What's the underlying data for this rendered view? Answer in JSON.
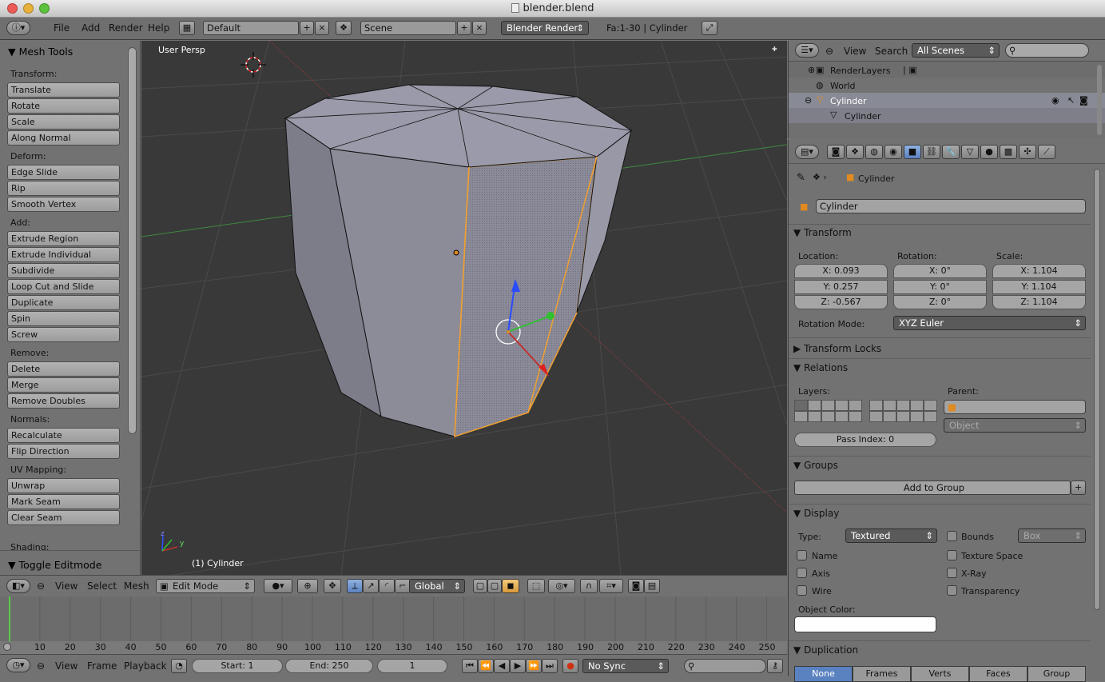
{
  "window": {
    "title": "blender.blend"
  },
  "topbar": {
    "menus": [
      "File",
      "Add",
      "Render",
      "Help"
    ],
    "layout": "Default",
    "scene": "Scene",
    "engine": "Blender Render",
    "stats": "Fa:1-30 | Cylinder"
  },
  "tools": {
    "title": "Mesh Tools",
    "sections": [
      {
        "label": "Transform:",
        "buttons": [
          "Translate",
          "Rotate",
          "Scale",
          "Along Normal"
        ]
      },
      {
        "label": "Deform:",
        "buttons": [
          "Edge Slide",
          "Rip",
          "Smooth Vertex"
        ]
      },
      {
        "label": "Add:",
        "buttons": [
          "Extrude Region",
          "Extrude Individual",
          "Subdivide",
          "Loop Cut and Slide",
          "Duplicate",
          "Spin",
          "Screw"
        ]
      },
      {
        "label": "Remove:",
        "buttons": [
          "Delete",
          "Merge",
          "Remove Doubles"
        ]
      },
      {
        "label": "Normals:",
        "buttons": [
          "Recalculate",
          "Flip Direction"
        ]
      },
      {
        "label": "UV Mapping:",
        "buttons": [
          "Unwrap",
          "Mark Seam",
          "Clear Seam"
        ]
      }
    ],
    "shading_label": "Shading:",
    "toggle": "Toggle Editmode"
  },
  "viewport": {
    "persp": "User Persp",
    "object": "(1) Cylinder"
  },
  "vpheader": {
    "menus": [
      "View",
      "Select",
      "Mesh"
    ],
    "mode": "Edit Mode",
    "orientation": "Global"
  },
  "timeline": {
    "ticks": [
      "10",
      "20",
      "30",
      "40",
      "50",
      "60",
      "70",
      "80",
      "90",
      "100",
      "110",
      "120",
      "130",
      "140",
      "150",
      "160",
      "170",
      "180",
      "190",
      "200",
      "210",
      "220",
      "230",
      "240",
      "250"
    ],
    "menus": [
      "View",
      "Frame",
      "Playback"
    ],
    "start": "Start: 1",
    "end": "End: 250",
    "current": "1",
    "sync": "No Sync"
  },
  "outliner": {
    "menus": [
      "View",
      "Search"
    ],
    "filter": "All Scenes",
    "items": [
      "RenderLayers",
      "World",
      "Cylinder",
      "Cylinder"
    ]
  },
  "props": {
    "breadcrumb": "Cylinder",
    "name": "Cylinder",
    "transform": {
      "title": "Transform",
      "location_label": "Location:",
      "rotation_label": "Rotation:",
      "scale_label": "Scale:",
      "location": [
        "X: 0.093",
        "Y: 0.257",
        "Z: -0.567"
      ],
      "rotation": [
        "X: 0°",
        "Y: 0°",
        "Z: 0°"
      ],
      "scale": [
        "X: 1.104",
        "Y: 1.104",
        "Z: 1.104"
      ],
      "mode_label": "Rotation Mode:",
      "mode": "XYZ Euler"
    },
    "locks_title": "Transform Locks",
    "relations": {
      "title": "Relations",
      "layers_label": "Layers:",
      "parent_label": "Parent:",
      "parent_type": "Object",
      "pass_index": "Pass Index: 0"
    },
    "groups": {
      "title": "Groups",
      "add": "Add to Group"
    },
    "display": {
      "title": "Display",
      "type_label": "Type:",
      "type": "Textured",
      "bounds": "Bounds",
      "bounds_type": "Box",
      "checks_left": [
        "Name",
        "Axis",
        "Wire"
      ],
      "checks_right": [
        "Texture Space",
        "X-Ray",
        "Transparency"
      ],
      "color_label": "Object Color:"
    },
    "duplication": {
      "title": "Duplication",
      "tabs": [
        "None",
        "Frames",
        "Verts",
        "Faces",
        "Group"
      ]
    }
  }
}
